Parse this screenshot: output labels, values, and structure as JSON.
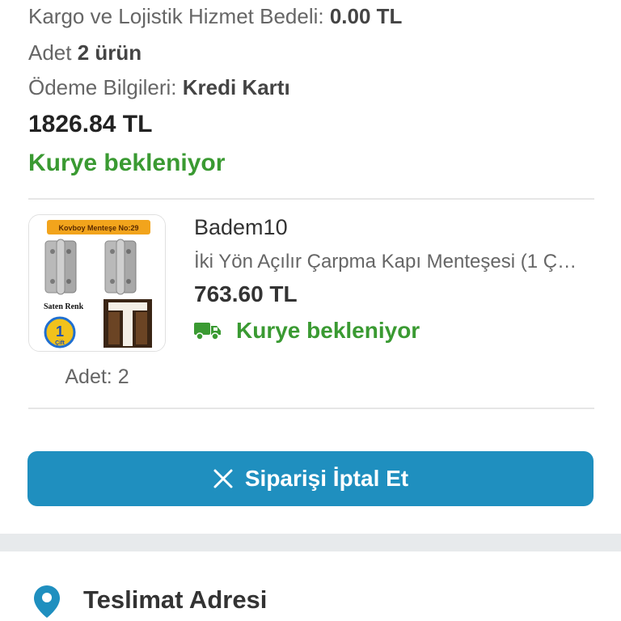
{
  "summary": {
    "shipping_label": "Kargo ve Lojistik Hizmet Bedeli:",
    "shipping_value": "0.00 TL",
    "quantity_label": "Adet",
    "quantity_value": "2 ürün",
    "payment_label": "Ödeme Bilgileri:",
    "payment_value": "Kredi Kartı",
    "total": "1826.84 TL",
    "status": "Kurye bekleniyor",
    "status_color": "#3a9a32"
  },
  "product": {
    "image_label": "Kovboy Menteşe No:29",
    "image_badge_text": "Saten Renk",
    "image_badge_count": "1",
    "image_badge_word": "Çift",
    "quantity": "Adet: 2",
    "seller": "Badem10",
    "name": "İki Yön Açılır Çarpma Kapı Menteşesi (1 Ç…",
    "price": "763.60 TL",
    "status": "Kurye bekleniyor",
    "status_icon": "truck-icon"
  },
  "actions": {
    "cancel_label": "Siparişi İptal Et",
    "cancel_icon": "close-icon",
    "cancel_color": "#1f8fbf"
  },
  "address": {
    "title": "Teslimat Adresi",
    "icon": "location-pin-icon",
    "icon_color": "#1f8fbf"
  }
}
